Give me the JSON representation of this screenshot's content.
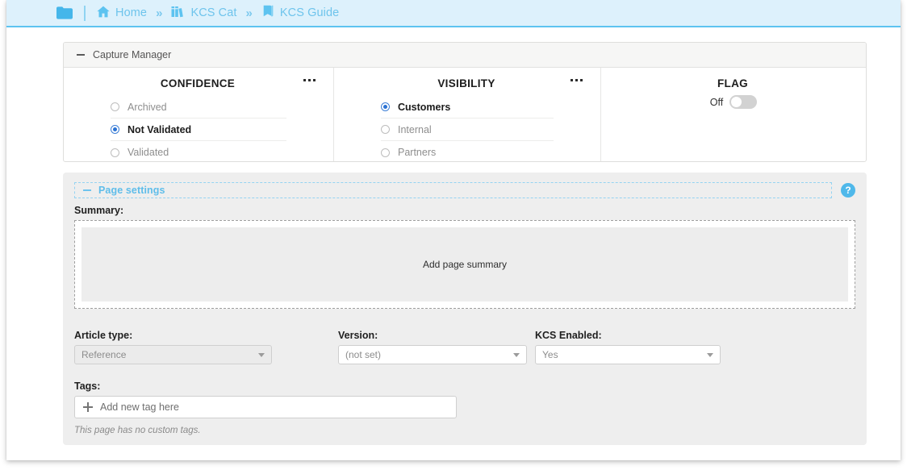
{
  "breadcrumb": {
    "folder_icon": "folder-icon",
    "items": [
      {
        "icon": "home-icon",
        "label": "Home"
      },
      {
        "icon": "books-icon",
        "label": "KCS Cat"
      },
      {
        "icon": "book-icon",
        "label": "KCS Guide"
      }
    ],
    "separator": "»"
  },
  "capture_manager": {
    "title": "Capture Manager",
    "collapse_icon": "minus-icon",
    "columns": [
      {
        "title": "CONFIDENCE",
        "menu_icon": "overflow-menu-icon",
        "options": [
          {
            "label": "Archived",
            "selected": false
          },
          {
            "label": "Not Validated",
            "selected": true
          },
          {
            "label": "Validated",
            "selected": false
          }
        ]
      },
      {
        "title": "VISIBILITY",
        "menu_icon": "overflow-menu-icon",
        "options": [
          {
            "label": "Customers",
            "selected": true
          },
          {
            "label": "Internal",
            "selected": false
          },
          {
            "label": "Partners",
            "selected": false
          }
        ]
      }
    ],
    "flag": {
      "title": "FLAG",
      "state_label": "Off",
      "enabled": false
    }
  },
  "page_settings": {
    "title": "Page settings",
    "collapse_icon": "minus-icon",
    "help_icon": "help-icon",
    "help_glyph": "?",
    "summary": {
      "label": "Summary:",
      "placeholder": "Add page summary"
    },
    "fields": [
      {
        "label": "Article type:",
        "value": "Reference",
        "disabled": true
      },
      {
        "label": "Version:",
        "value": "(not set)",
        "disabled": false
      },
      {
        "label": "KCS Enabled:",
        "value": "Yes",
        "disabled": false
      }
    ],
    "tags": {
      "label": "Tags:",
      "add_icon": "plus-icon",
      "placeholder": "Add new tag here",
      "empty_note": "This page has no custom tags."
    }
  },
  "colors": {
    "breadcrumb_bg": "#ddf1fc",
    "breadcrumb_border": "#5dc3f0",
    "breadcrumb_text": "#6ec4ec",
    "accent_blue": "#4fb8ea",
    "radio_selected": "#2a72d4",
    "panel_bg": "#eeeeee"
  }
}
